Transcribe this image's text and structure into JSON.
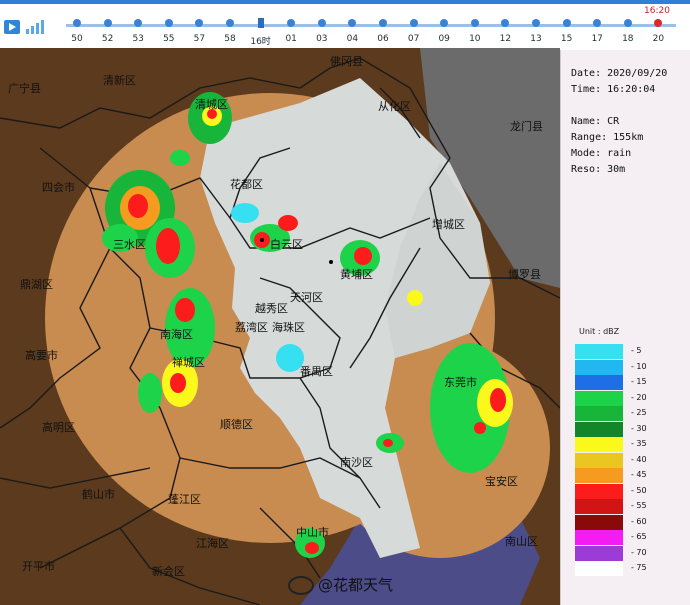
{
  "timeline": {
    "labels": [
      "50",
      "52",
      "53",
      "55",
      "57",
      "58",
      "16时",
      "01",
      "03",
      "04",
      "06",
      "07",
      "09",
      "10",
      "12",
      "13",
      "15",
      "17",
      "18",
      "20"
    ],
    "current_time": "16:20"
  },
  "info": {
    "date": "Date: 2020/09/20",
    "time": "Time: 16:20:04",
    "name": "Name: CR",
    "range": "Range: 155km",
    "mode": "Mode: rain",
    "reso": "Reso: 30m"
  },
  "legend": {
    "unit": "Unit : dBZ",
    "levels": [
      {
        "v": "5",
        "c": "#36e0f0"
      },
      {
        "v": "10",
        "c": "#20b8ee"
      },
      {
        "v": "15",
        "c": "#1e6fe6"
      },
      {
        "v": "20",
        "c": "#1dd34a"
      },
      {
        "v": "25",
        "c": "#17b53a"
      },
      {
        "v": "30",
        "c": "#14862a"
      },
      {
        "v": "35",
        "c": "#fbf81c"
      },
      {
        "v": "40",
        "c": "#e9c620"
      },
      {
        "v": "45",
        "c": "#f59b20"
      },
      {
        "v": "50",
        "c": "#fc1c1c"
      },
      {
        "v": "55",
        "c": "#d11515"
      },
      {
        "v": "60",
        "c": "#8a0a0a"
      },
      {
        "v": "65",
        "c": "#f51cf3"
      },
      {
        "v": "70",
        "c": "#9b3cd6"
      },
      {
        "v": "75",
        "c": "#ffffff"
      }
    ]
  },
  "places": {
    "fogang": "佛冈县",
    "guangning": "广宁县",
    "qingxin": "清新区",
    "qingcheng": "清城区",
    "conghua": "从化区",
    "longmen": "龙门县",
    "sihui": "四会市",
    "huadu": "花都区",
    "zengcheng": "增城区",
    "sanshui": "三水区",
    "baiyun": "白云区",
    "huangpu": "黄埔区",
    "dinghu": "鼎湖区",
    "tianhe": "天河区",
    "yuexiu": "越秀区",
    "boluo": "博罗县",
    "nanhai": "南海区",
    "liwan": "荔湾区",
    "haizhu": "海珠区",
    "gaoyao": "高要市",
    "chancheng": "禅城区",
    "panyu": "番禺区",
    "dongguan": "东莞市",
    "gaoming": "高明区",
    "shunde": "顺德区",
    "nansha": "南沙区",
    "baoan": "宝安区",
    "heshan": "鹤山市",
    "pengjiang": "蓬江区",
    "jianghai": "江海区",
    "nanshan": "南山区",
    "kaiping": "开平市",
    "xinhui": "新会区",
    "zhongshan": "中山市"
  },
  "watermark": "@花都天气"
}
